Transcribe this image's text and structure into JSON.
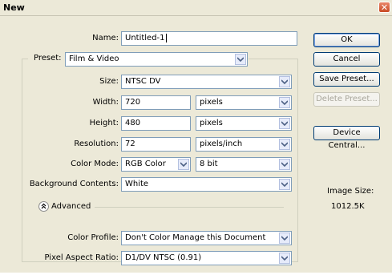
{
  "dialog": {
    "title": "New",
    "close_glyph": "✕"
  },
  "form": {
    "name_label": "Name:",
    "name_value": "Untitled-1",
    "preset_label": "Preset:",
    "preset_value": "Film & Video",
    "size_label": "Size:",
    "size_value": "NTSC DV",
    "width_label": "Width:",
    "width_value": "720",
    "width_unit": "pixels",
    "height_label": "Height:",
    "height_value": "480",
    "height_unit": "pixels",
    "resolution_label": "Resolution:",
    "resolution_value": "72",
    "resolution_unit": "pixels/inch",
    "color_mode_label": "Color Mode:",
    "color_mode_value": "RGB Color",
    "bit_depth_value": "8 bit",
    "background_label": "Background Contents:",
    "background_value": "White",
    "advanced_label": "Advanced",
    "color_profile_label": "Color Profile:",
    "color_profile_value": "Don't Color Manage this Document",
    "pixel_aspect_label": "Pixel Aspect Ratio:",
    "pixel_aspect_value": "D1/DV NTSC (0.91)"
  },
  "buttons": {
    "ok": "OK",
    "cancel": "Cancel",
    "save_preset": "Save Preset...",
    "delete_preset": "Delete Preset...",
    "device_central": "Device Central..."
  },
  "info": {
    "image_size_label": "Image Size:",
    "image_size_value": "1012.5K"
  },
  "icons": {
    "dropdown": "chevron-down-icon",
    "advanced": "double-chevron-up-icon",
    "close": "close-icon"
  },
  "colors": {
    "dialog_bg": "#ece9d8",
    "field_border": "#7f9db9",
    "close_red": "#c94a24"
  }
}
